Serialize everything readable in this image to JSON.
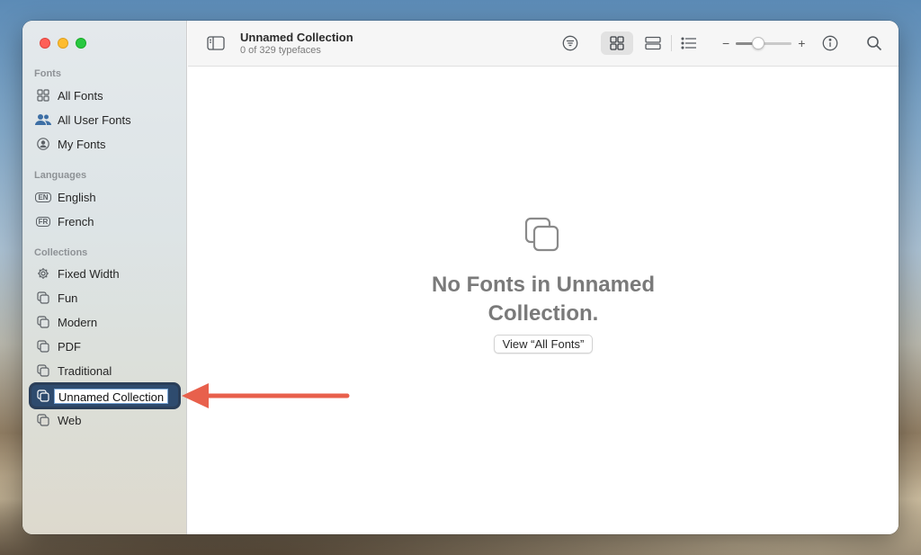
{
  "window": {
    "title": "Unnamed Collection",
    "subtitle": "0 of 329 typefaces"
  },
  "sidebar": {
    "sections": {
      "fonts": "Fonts",
      "languages": "Languages",
      "collections": "Collections"
    },
    "fonts_items": [
      {
        "label": "All Fonts",
        "icon": "grid-icon"
      },
      {
        "label": "All User Fonts",
        "icon": "users-icon"
      },
      {
        "label": "My Fonts",
        "icon": "person-circle-icon"
      }
    ],
    "language_items": [
      {
        "label": "English",
        "badge": "EN"
      },
      {
        "label": "French",
        "badge": "FR"
      }
    ],
    "collection_items": [
      {
        "label": "Fixed Width",
        "icon": "gear-icon"
      },
      {
        "label": "Fun",
        "icon": "collection-icon"
      },
      {
        "label": "Modern",
        "icon": "collection-icon"
      },
      {
        "label": "PDF",
        "icon": "collection-icon"
      },
      {
        "label": "Traditional",
        "icon": "collection-icon"
      },
      {
        "label": "Unnamed Collection",
        "icon": "collection-icon",
        "selected": true,
        "editing": true
      },
      {
        "label": "Web",
        "icon": "collection-icon"
      }
    ]
  },
  "toolbar": {
    "zoom_minus": "−",
    "zoom_plus": "+",
    "zoom_level": 0.4
  },
  "content": {
    "empty_title": "No Fonts in Unnamed Collection.",
    "view_all_button": "View “All Fonts”"
  },
  "colors": {
    "selection": "#2e4b6e",
    "arrow": "#e8604c"
  }
}
